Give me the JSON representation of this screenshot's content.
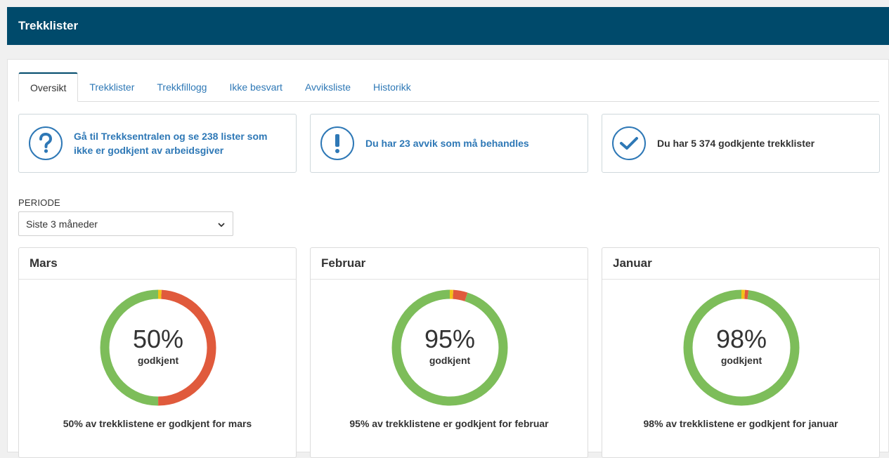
{
  "header": {
    "title": "Trekklister"
  },
  "tabs": [
    {
      "label": "Oversikt",
      "active": true
    },
    {
      "label": "Trekklister"
    },
    {
      "label": "Trekkfillogg"
    },
    {
      "label": "Ikke besvart"
    },
    {
      "label": "Avviksliste"
    },
    {
      "label": "Historikk"
    }
  ],
  "info_cards": [
    {
      "icon": "question-icon",
      "text": "Gå til Trekksentralen og se 238 lister som ikke er godkjent av arbeidsgiver"
    },
    {
      "icon": "exclamation-icon",
      "text": "Du har 23 avvik som må behandles"
    },
    {
      "icon": "checkmark-icon",
      "text": "Du har 5 374 godkjente trekklister"
    }
  ],
  "periode": {
    "label": "PERIODE",
    "selected": "Siste 3 måneder"
  },
  "colors": {
    "approved": "#7dbd5a",
    "deviation": "#e05a3c",
    "pending": "#f2c418",
    "brand": "#004a6b",
    "link": "#2e78b6"
  },
  "months": [
    {
      "name": "Mars",
      "percent_label": "50%",
      "sub_label": "godkjent",
      "caption": "50% av trekklistene er godkjent for mars",
      "segments": {
        "approved": 0.5,
        "deviation": 0.49,
        "pending": 0.01
      }
    },
    {
      "name": "Februar",
      "percent_label": "95%",
      "sub_label": "godkjent",
      "caption": "95% av trekklistene er godkjent for februar",
      "segments": {
        "approved": 0.95,
        "deviation": 0.04,
        "pending": 0.01
      }
    },
    {
      "name": "Januar",
      "percent_label": "98%",
      "sub_label": "godkjent",
      "caption": "98% av trekklistene er godkjent for januar",
      "segments": {
        "approved": 0.98,
        "deviation": 0.01,
        "pending": 0.01
      }
    }
  ]
}
